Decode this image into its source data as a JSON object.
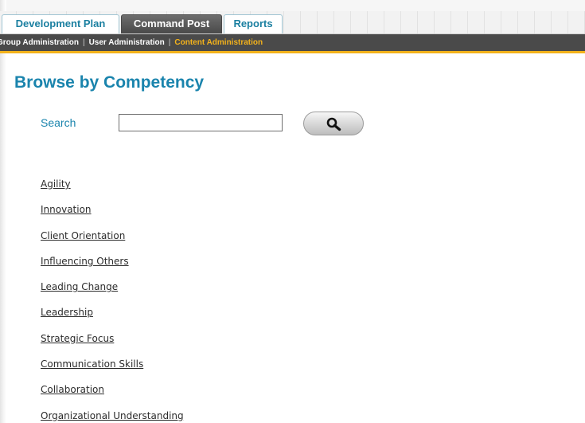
{
  "tabs": [
    {
      "label": "Development Plan",
      "active": false
    },
    {
      "label": "Command Post",
      "active": true
    },
    {
      "label": "Reports",
      "active": false
    }
  ],
  "subnav": {
    "items": [
      {
        "label": "Group Administration",
        "current": false
      },
      {
        "label": "User Administration",
        "current": false
      },
      {
        "label": "Content Administration",
        "current": true
      }
    ],
    "separator": "|"
  },
  "page": {
    "title": "Browse by Competency"
  },
  "search": {
    "label": "Search",
    "value": "",
    "placeholder": "",
    "button_icon": "magnifier-icon"
  },
  "competencies": [
    "Agility",
    "Innovation",
    "Client Orientation",
    "Influencing Others",
    "Leading Change",
    "Leadership",
    "Strategic Focus",
    "Communication Skills",
    "Collaboration",
    "Organizational Understanding"
  ],
  "colors": {
    "accent_blue": "#1a84ad",
    "nav_dark": "#4a4a4a",
    "nav_highlight": "#f3b21b"
  }
}
